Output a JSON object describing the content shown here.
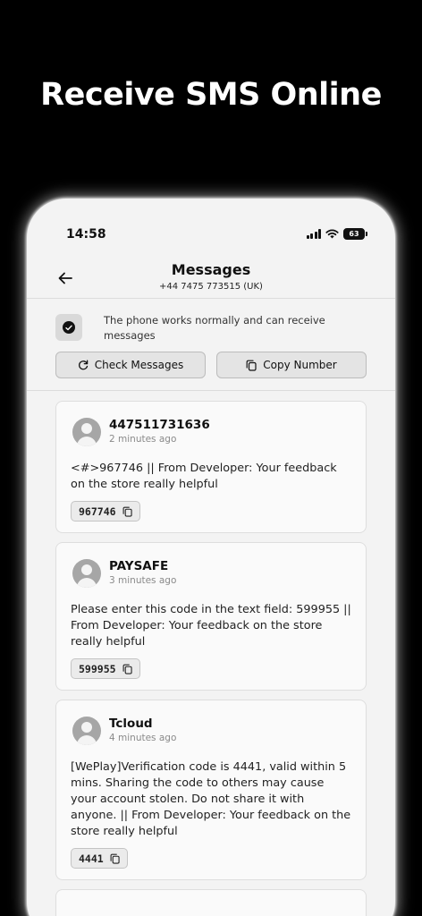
{
  "promo": {
    "title": "Receive SMS Online"
  },
  "status_bar": {
    "time": "14:58",
    "battery": "63"
  },
  "header": {
    "title": "Messages",
    "number": "+44 7475 773515 (UK)"
  },
  "notice": {
    "text": "The phone works normally and can receive messages"
  },
  "actions": {
    "check": "Check Messages",
    "copy": "Copy Number"
  },
  "messages": [
    {
      "sender": "447511731636",
      "time": "2 minutes ago",
      "text": "<#>967746 || From Developer: Your feedback on the store really helpful",
      "code": "967746"
    },
    {
      "sender": "PAYSAFE",
      "time": "3 minutes ago",
      "text": "Please enter this code in the text field: 599955 || From Developer: Your feedback on the store really helpful",
      "code": "599955"
    },
    {
      "sender": "Tcloud",
      "time": "4 minutes ago",
      "text": "[WePlay]Verification code is 4441, valid within 5 mins. Sharing the code to others may cause your account stolen. Do not share it with anyone. || From Developer: Your feedback on the store really helpful",
      "code": "4441"
    }
  ]
}
